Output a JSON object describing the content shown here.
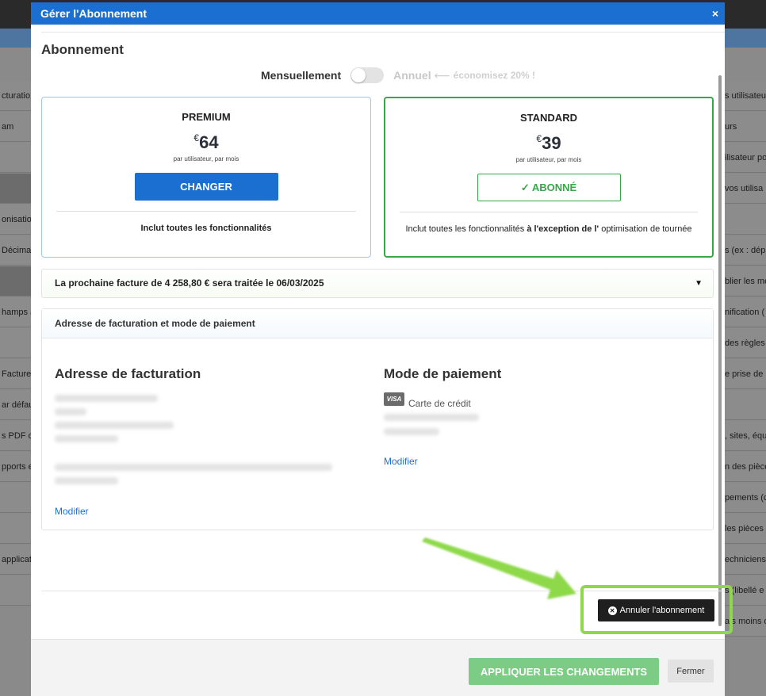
{
  "background": {
    "left_items": [
      "cturatio",
      "am",
      "",
      "",
      "onisation",
      "Décimale",
      "",
      "hamps a",
      "",
      "Facture",
      "ar défaut",
      "s PDF de",
      "pports et",
      "",
      "",
      "applicati",
      ""
    ],
    "right_items": [
      "s utilisateurs",
      "urs",
      "ilisateur po",
      "vos utilisa",
      "",
      "s (ex : dép",
      "blier les mo",
      "nification (",
      "des règles",
      "e prise de R",
      "",
      ", sites, équ",
      "n des pièces",
      "pements (c",
      "les pièces j",
      "echniciens",
      "s (libellé e",
      "ais moins d"
    ]
  },
  "modal": {
    "title": "Gérer l'Abonnement",
    "close": "×",
    "section_title": "Abonnement",
    "toggle": {
      "monthly": "Mensuellement",
      "annual": "Annuel",
      "arrow": "⟵",
      "save": "économisez 20% !"
    },
    "plans": {
      "premium": {
        "name": "PREMIUM",
        "currency": "€",
        "price": "64",
        "unit": "par utilisateur, par mois",
        "button": "CHANGER",
        "feature": "Inclut toutes les fonctionnalités"
      },
      "standard": {
        "name": "STANDARD",
        "currency": "€",
        "price": "39",
        "unit": "par utilisateur, par mois",
        "button": "✓ ABONNÉ",
        "feature_pre": "Inclut toutes les fonctionnalités ",
        "feature_bold": "à l'exception de l'",
        "feature_post": " optimisation de tournée"
      }
    },
    "invoice": "La prochaine facture de 4 258,80 € sera traitée le 06/03/2025",
    "billing": {
      "header": "Adresse de facturation et mode de paiement",
      "address_title": "Adresse de facturation",
      "address_link": "Modifier",
      "payment_title": "Mode de paiement",
      "card_brand": "VISA",
      "card_label": "Carte de crédit",
      "payment_link": "Modifier"
    },
    "cancel_button": "Annuler l'abonnement",
    "cancel_icon": "x-circle-icon",
    "apply_button": "APPLIQUER LES CHANGEMENTS",
    "close_button": "Fermer"
  },
  "colors": {
    "header_blue": "#1b6fd1",
    "standard_green": "#3aa64a",
    "apply_green": "#7dcc86",
    "highlight_green": "#8ed94a"
  }
}
